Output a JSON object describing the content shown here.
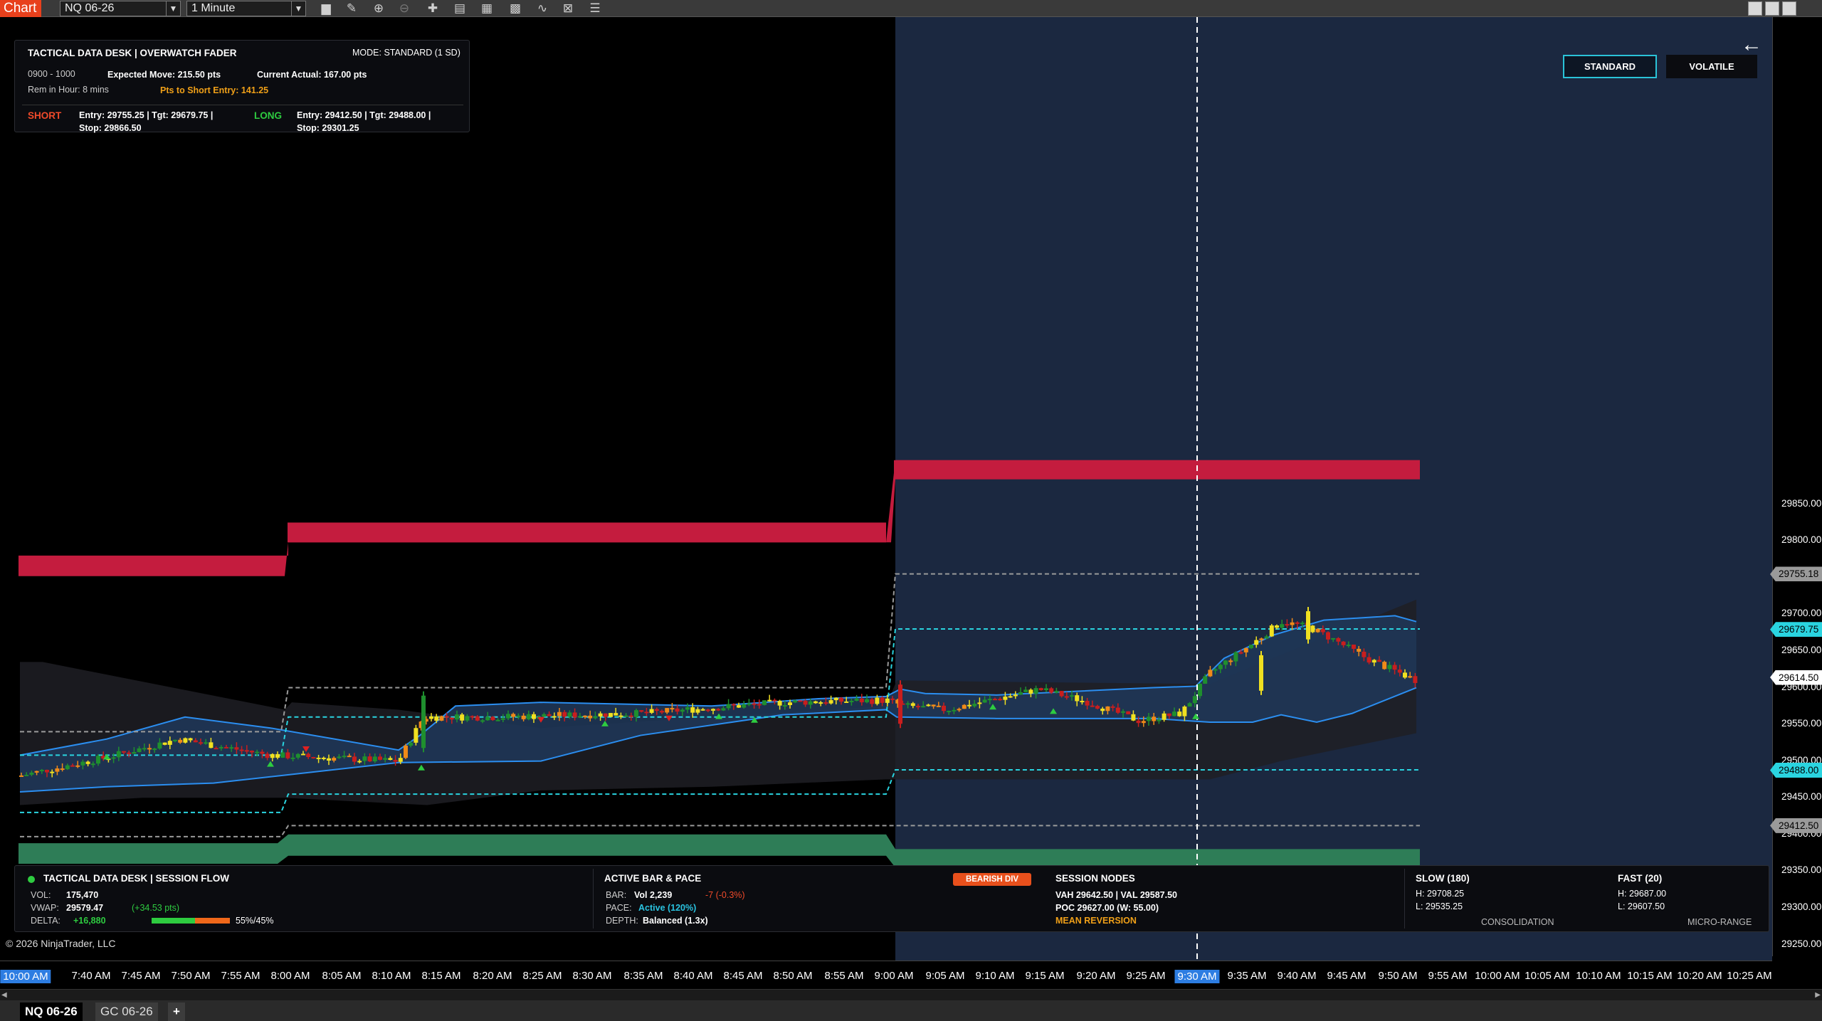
{
  "toolbar": {
    "chart_tab": "Chart",
    "instrument": "NQ 06-26",
    "interval": "1 Minute",
    "icons": [
      "bar-type-icon",
      "pencil-icon",
      "zoom-in-icon",
      "zoom-out-icon",
      "crosshair-icon",
      "properties-icon",
      "templates-icon",
      "indicators-icon",
      "strategies-icon",
      "data-box-icon",
      "list-icon"
    ]
  },
  "info_panel": {
    "title": "TACTICAL DATA DESK  |  OVERWATCH FADER",
    "mode": "MODE: STANDARD (1 SD)",
    "hour": "0900 - 1000",
    "expected_move": "Expected Move: 215.50 pts",
    "current_actual": "Current Actual: 167.00 pts",
    "rem_in_hour": "Rem in Hour: 8 mins",
    "pts_to_short": "Pts to Short Entry: 141.25",
    "short_label": "SHORT",
    "short_line1": "Entry: 29755.25  |  Tgt: 29679.75  |",
    "short_line2": "Stop: 29866.50",
    "long_label": "LONG",
    "long_line1": "Entry: 29412.50  |  Tgt: 29488.00  |",
    "long_line2": "Stop: 29301.25"
  },
  "mode_buttons": {
    "standard": "STANDARD",
    "volatile": "VOLATILE"
  },
  "session_panel": {
    "title": "TACTICAL DATA DESK  |  SESSION FLOW",
    "vol_label": "VOL:",
    "vol_value": "175,470",
    "vwap_label": "VWAP:",
    "vwap_value": "29579.47",
    "vwap_delta": "(+34.53 pts)",
    "delta_label": "DELTA:",
    "delta_value": "+16,880",
    "delta_ratio": "55%/45%",
    "delta_buy_pct": 0.55,
    "active_title": "ACTIVE BAR & PACE",
    "bar_label": "BAR:",
    "bar_value": "Vol 2,239",
    "bar_change": "-7 (-0.3%)",
    "pace_label": "PACE:",
    "pace_value": "Active (120%)",
    "depth_label": "DEPTH:",
    "depth_value": "Balanced (1.3x)",
    "div_badge": "BEARISH DIV",
    "nodes_title": "SESSION NODES",
    "vah_val": "VAH 29642.50  |  VAL 29587.50",
    "poc": "POC 29627.00 (W: 55.00)",
    "nodes_state": "MEAN REVERSION",
    "slow_title": "SLOW (180)",
    "slow_h": "H: 29708.25",
    "slow_l": "L: 29535.25",
    "slow_state": "CONSOLIDATION",
    "fast_title": "FAST (20)",
    "fast_h": "H: 29687.00",
    "fast_l": "L: 29607.50",
    "fast_state": "MICRO-RANGE"
  },
  "copyright": "© 2026 NinjaTrader, LLC",
  "price_axis": {
    "ticks": [
      "29850.00",
      "29800.00",
      "29750.00",
      "29700.00",
      "29650.00",
      "29600.00",
      "29550.00",
      "29500.00",
      "29450.00",
      "29400.00",
      "29350.00",
      "29300.00",
      "29250.00"
    ],
    "markers": [
      {
        "text": "29755.18",
        "price": 29755.18,
        "color": "#9a9a9a"
      },
      {
        "text": "29679.75",
        "price": 29679.75,
        "color": "#2ad4e0"
      },
      {
        "text": "29614.50",
        "price": 29614.5,
        "color": "#ffffff"
      },
      {
        "text": "29488.00",
        "price": 29488.0,
        "color": "#2ad4e0"
      },
      {
        "text": "29412.50",
        "price": 29412.5,
        "color": "#9a9a9a"
      }
    ]
  },
  "time_axis": {
    "labels": [
      "10:00 AM",
      "7:40 AM",
      "7:45 AM",
      "7:50 AM",
      "7:55 AM",
      "8:00 AM",
      "8:05 AM",
      "8:10 AM",
      "8:15 AM",
      "8:20 AM",
      "8:25 AM",
      "8:30 AM",
      "8:35 AM",
      "8:40 AM",
      "8:45 AM",
      "8:50 AM",
      "8:55 AM",
      "9:00 AM",
      "9:05 AM",
      "9:10 AM",
      "9:15 AM",
      "9:20 AM",
      "9:25 AM",
      "9:30 AM",
      "9:35 AM",
      "9:40 AM",
      "9:45 AM",
      "9:50 AM",
      "9:55 AM",
      "10:00 AM",
      "10:05 AM",
      "10:10 AM",
      "10:15 AM",
      "10:20 AM",
      "10:25 AM"
    ],
    "highlighted": [
      "10:00 AM",
      "9:30 AM"
    ]
  },
  "bottom_tabs": [
    "NQ 06-26",
    "GC 06-26",
    "+"
  ],
  "colors": {
    "short_zone": "#c41c3e",
    "long_zone": "#2e7d57",
    "cyan": "#2ad4e0",
    "band_blue": "#2b8ef0",
    "session_bg": "#1b2840",
    "up": "#1f8f2e",
    "down": "#c81e1e",
    "yellow": "#f0e020",
    "orange": "#f08a18"
  }
}
